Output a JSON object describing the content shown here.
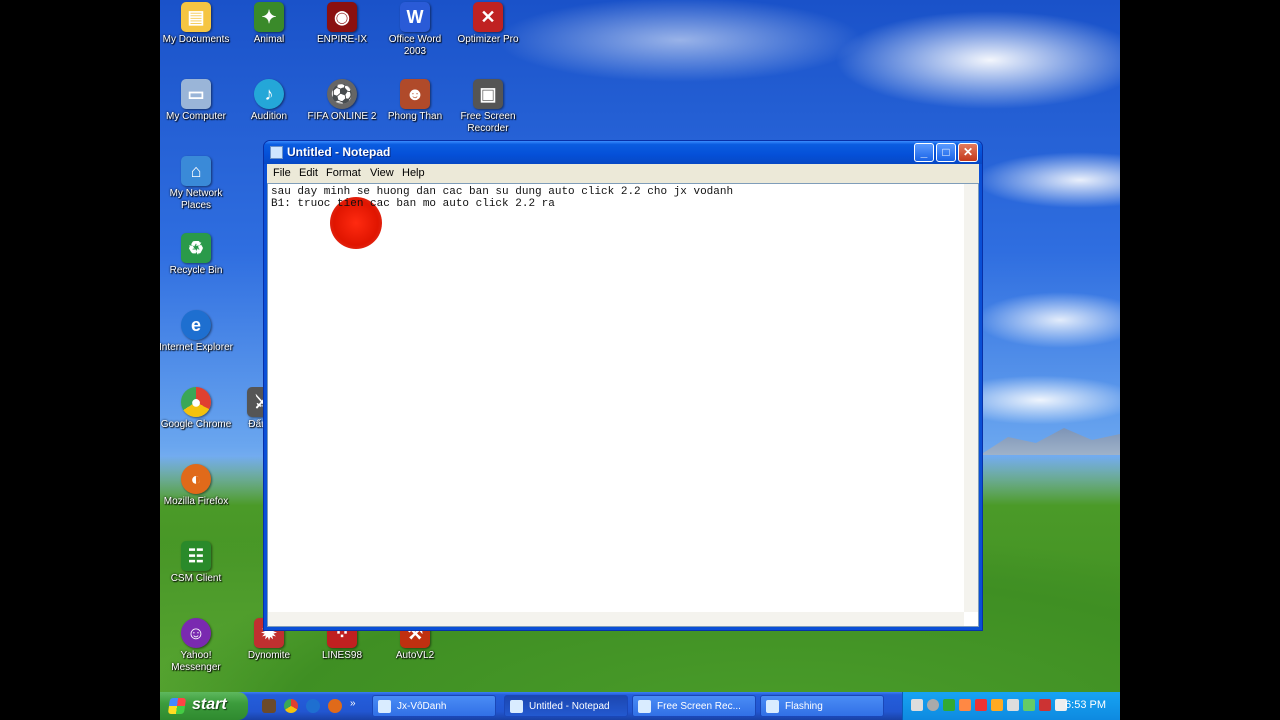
{
  "desktop_icons": [
    {
      "label": "My Documents",
      "icon": "folder-icon",
      "color": "#f5c542"
    },
    {
      "label": "Animal",
      "icon": "animal-game-icon",
      "color": "#3a8a2a"
    },
    {
      "label": "ENPIRE-IX",
      "icon": "game-icon",
      "color": "#8b1010"
    },
    {
      "label": "Office Word 2003",
      "icon": "word-icon",
      "color": "#2a5bd7"
    },
    {
      "label": "Optimizer Pro",
      "icon": "tools-icon",
      "color": "#c02222"
    },
    {
      "label": "My Computer",
      "icon": "computer-icon",
      "color": "#9ab5d8"
    },
    {
      "label": "Audition",
      "icon": "audition-icon",
      "color": "#24a7d8"
    },
    {
      "label": "FIFA ONLINE 2",
      "icon": "fifa-icon",
      "color": "#666666"
    },
    {
      "label": "Phong Than",
      "icon": "phong-than-icon",
      "color": "#b04a2a"
    },
    {
      "label": "Free Screen Recorder",
      "icon": "recorder-icon",
      "color": "#555555"
    },
    {
      "label": "My Network Places",
      "icon": "network-icon",
      "color": "#3a8ad8"
    },
    {
      "label": "Recycle Bin",
      "icon": "recycle-bin-icon",
      "color": "#2a9a4a"
    },
    {
      "label": "Internet Explorer",
      "icon": "ie-icon",
      "color": "#1e6fd0"
    },
    {
      "label": "Google Chrome",
      "icon": "chrome-icon",
      "color": "#e04030"
    },
    {
      "label": "Mozilla Firefox",
      "icon": "firefox-icon",
      "color": "#e06a1a"
    },
    {
      "label": "CSM Client",
      "icon": "csm-client-icon",
      "color": "#2a8a2a"
    },
    {
      "label": "Yahoo! Messenger",
      "icon": "yahoo-messenger-icon",
      "color": "#7a2ab0"
    },
    {
      "label": "Dynomite",
      "icon": "dynomite-icon",
      "color": "#c03030"
    },
    {
      "label": "LINES98",
      "icon": "lines98-icon",
      "color": "#c02020"
    },
    {
      "label": "AutoVL2",
      "icon": "autovl2-icon",
      "color": "#c03010"
    },
    {
      "label": "Đấu tr",
      "icon": "game-shortcut-icon",
      "color": "#555555"
    }
  ],
  "notepad": {
    "title": "Untitled - Notepad",
    "menu": [
      "File",
      "Edit",
      "Format",
      "View",
      "Help"
    ],
    "lines": [
      "sau day minh se huong dan cac ban su dung auto click 2.2 cho jx vodanh",
      "B1: truoc tien cac ban mo auto click 2.2 ra"
    ],
    "minimize": "_",
    "maximize": "□",
    "close": "✕"
  },
  "taskbar": {
    "start_label": "start",
    "tasks": [
      {
        "label": "Jx-VôDanh",
        "active": false
      },
      {
        "label": "Untitled - Notepad",
        "active": true
      },
      {
        "label": "Free Screen Rec...",
        "active": false
      },
      {
        "label": "Flashing",
        "active": false
      }
    ],
    "clock": "6:53 PM"
  }
}
